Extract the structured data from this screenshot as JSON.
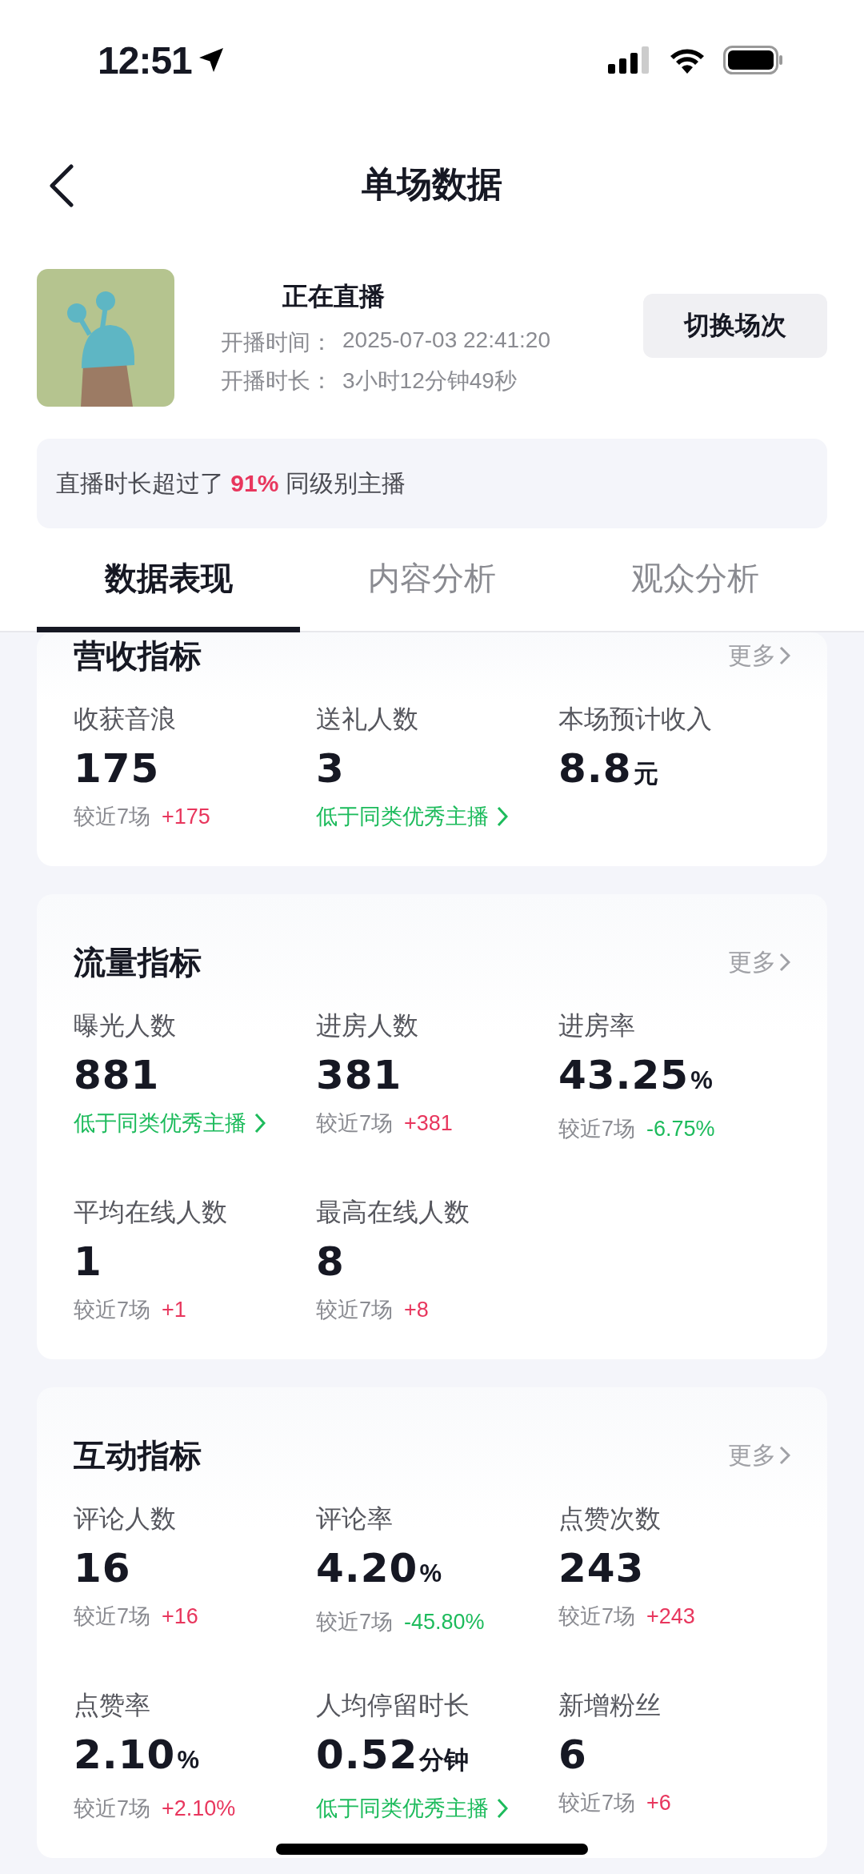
{
  "status_bar": {
    "time": "12:51"
  },
  "header": {
    "title": "单场数据"
  },
  "live": {
    "status": "正在直播",
    "lines": [
      {
        "label": "开播时间：",
        "value": "2025-07-03 22:41:20"
      },
      {
        "label": "开播时长：",
        "value": "3小时12分钟49秒"
      }
    ],
    "button": "切换场次"
  },
  "notice": "直播时长超过了 **91%** 同级别主播",
  "tabs": [
    {
      "label": "数据表现",
      "selected": true
    },
    {
      "label": "内容分析",
      "selected": false
    },
    {
      "label": "观众分析",
      "selected": false
    }
  ],
  "cards": [
    {
      "title": "营收指标",
      "more": "更多",
      "metrics": [
        {
          "label": "收获音浪",
          "value": "175",
          "note": {
            "kind": "compare",
            "prefix": "较近7场",
            "delta": "+175",
            "color": "#e8365d"
          }
        },
        {
          "label": "送礼人数",
          "value": "3",
          "note": {
            "kind": "benchmark",
            "text": "低于同类优秀主播"
          }
        },
        {
          "label": "本场预计收入",
          "value": "8.8",
          "unit": "元"
        }
      ]
    },
    {
      "title": "流量指标",
      "more": "更多",
      "metrics": [
        {
          "label": "曝光人数",
          "value": "881",
          "note": {
            "kind": "benchmark",
            "text": "低于同类优秀主播"
          }
        },
        {
          "label": "进房人数",
          "value": "381",
          "note": {
            "kind": "compare",
            "prefix": "较近7场",
            "delta": "+381",
            "color": "#e8365d"
          }
        },
        {
          "label": "进房率",
          "value": "43.25",
          "unit": "%",
          "note": {
            "kind": "compare",
            "prefix": "较近7场",
            "delta": "-6.75%",
            "color": "#1dbb5c"
          }
        },
        {
          "label": "平均在线人数",
          "value": "1",
          "note": {
            "kind": "compare",
            "prefix": "较近7场",
            "delta": "+1",
            "color": "#e8365d"
          }
        },
        {
          "label": "最高在线人数",
          "value": "8",
          "note": {
            "kind": "compare",
            "prefix": "较近7场",
            "delta": "+8",
            "color": "#e8365d"
          }
        }
      ]
    },
    {
      "title": "互动指标",
      "more": "更多",
      "metrics": [
        {
          "label": "评论人数",
          "value": "16",
          "note": {
            "kind": "compare",
            "prefix": "较近7场",
            "delta": "+16",
            "color": "#e8365d"
          }
        },
        {
          "label": "评论率",
          "value": "4.20",
          "unit": "%",
          "note": {
            "kind": "compare",
            "prefix": "较近7场",
            "delta": "-45.80%",
            "color": "#1dbb5c"
          }
        },
        {
          "label": "点赞次数",
          "value": "243",
          "note": {
            "kind": "compare",
            "prefix": "较近7场",
            "delta": "+243",
            "color": "#e8365d"
          }
        },
        {
          "label": "点赞率",
          "value": "2.10",
          "unit": "%",
          "note": {
            "kind": "compare",
            "prefix": "较近7场",
            "delta": "+2.10%",
            "color": "#e8365d"
          }
        },
        {
          "label": "人均停留时长",
          "value": "0.52",
          "unit": "分钟",
          "note": {
            "kind": "benchmark",
            "text": "低于同类优秀主播"
          }
        },
        {
          "label": "新增粉丝",
          "value": "6",
          "note": {
            "kind": "compare",
            "prefix": "较近7场",
            "delta": "+6",
            "color": "#e8365d"
          }
        }
      ]
    }
  ]
}
